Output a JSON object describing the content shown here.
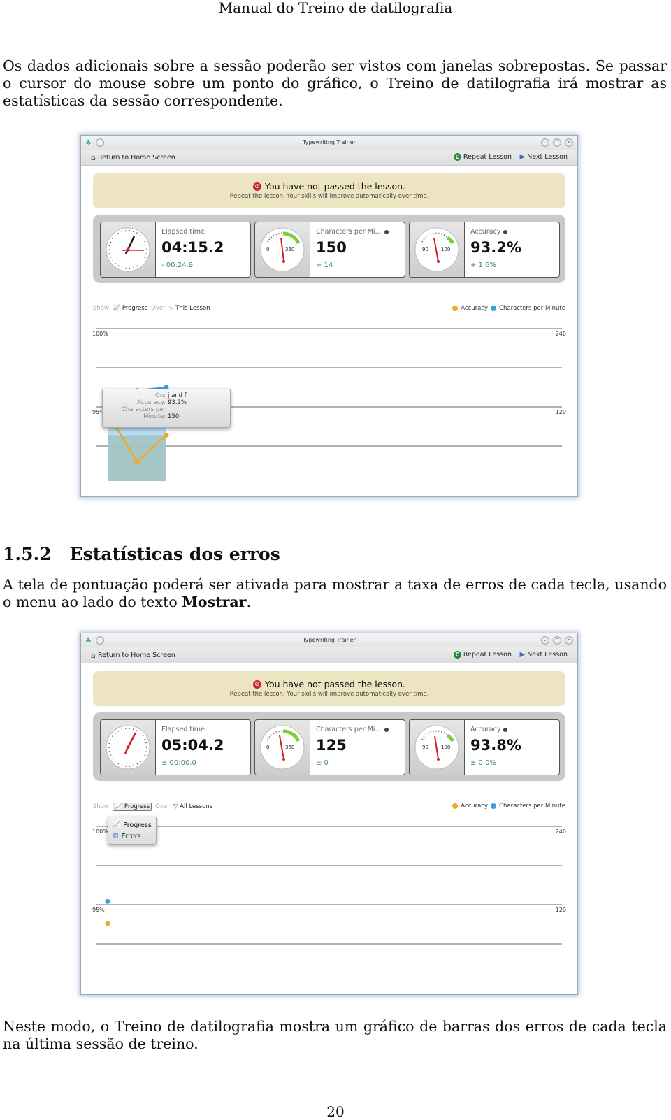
{
  "page": {
    "running_head": "Manual do Treino de datilografia",
    "intro_paragraph": "Os dados adicionais sobre a sessão poderão ser vistos com janelas sobrepostas. Se passar o cursor do mouse sobre um ponto do gráfico, o Treino de datilografia irá mostrar as estatísticas da sessão correspondente.",
    "section": {
      "number": "1.5.2",
      "title": "Estatísticas dos erros"
    },
    "section_paragraph_pre": "A tela de pontuação poderá ser ativada para mostrar a taxa de erros de cada tecla, usando o menu ao lado do texto ",
    "section_paragraph_bold": "Mostrar",
    "section_paragraph_post": ".",
    "closing_paragraph": "Neste modo, o Treino de datilografia mostra um gráfico de barras dos erros de cada tecla na última sessão de treino.",
    "page_number": "20"
  },
  "colors": {
    "accuracy": "#f5a623",
    "cpm": "#3a9fdc",
    "banner_bg": "#ede4c2",
    "delta_text": "#3b8a5a"
  },
  "screenshots": [
    {
      "window_title": "Typewriting Trainer",
      "toolbar": {
        "home": "Return to Home Screen",
        "repeat": "Repeat Lesson",
        "next": "Next Lesson"
      },
      "banner": {
        "title": "You have not passed the lesson.",
        "subtitle": "Repeat the lesson. Your skills will improve automatically over time."
      },
      "stats": {
        "elapsed": {
          "label": "Elapsed time",
          "value": "04:15.2",
          "delta": "- 00:24.9"
        },
        "cpm": {
          "label": "Characters per Mi...",
          "value": "150",
          "delta": "+ 14",
          "gauge_min": "0",
          "gauge_max": "360"
        },
        "accuracy": {
          "label": "Accuracy",
          "value": "93.2%",
          "delta": "+ 1.6%",
          "gauge_min": "90",
          "gauge_max": "100"
        }
      },
      "chart_bar": {
        "show": "Show",
        "mode": "Progress",
        "over": "Over",
        "scope": "This Lesson",
        "legend_accuracy": "Accuracy",
        "legend_cpm": "Characters per Minute"
      },
      "axis": {
        "left_top": "100%",
        "left_mid": "95%",
        "right_top": "240",
        "right_mid": "120"
      },
      "tooltip": {
        "on_label": "On:",
        "on_value": "j and f",
        "acc_label": "Accuracy:",
        "acc_value": "93.2%",
        "cpm_label_1": "Characters per",
        "cpm_label_2": "Minute:",
        "cpm_value": "150"
      }
    },
    {
      "window_title": "Typewriting Trainer",
      "toolbar": {
        "home": "Return to Home Screen",
        "repeat": "Repeat Lesson",
        "next": "Next Lesson"
      },
      "banner": {
        "title": "You have not passed the lesson.",
        "subtitle": "Repeat the lesson. Your skills will improve automatically over time."
      },
      "stats": {
        "elapsed": {
          "label": "Elapsed time",
          "value": "05:04.2",
          "delta": "± 00:00.0"
        },
        "cpm": {
          "label": "Characters per Mi...",
          "value": "125",
          "delta": "± 0",
          "gauge_min": "0",
          "gauge_max": "360"
        },
        "accuracy": {
          "label": "Accuracy",
          "value": "93.8%",
          "delta": "± 0.0%",
          "gauge_min": "90",
          "gauge_max": "100"
        }
      },
      "chart_bar": {
        "show": "Show",
        "mode": "Progress",
        "over": "Over",
        "scope": "All Lessons",
        "legend_accuracy": "Accuracy",
        "legend_cpm": "Characters per Minute"
      },
      "axis": {
        "left_top": "100%",
        "left_mid": "95%",
        "right_top": "240",
        "right_mid": "120"
      },
      "menu": {
        "items": [
          "Progress",
          "Errors"
        ]
      }
    }
  ],
  "chart_data": [
    {
      "type": "line",
      "title": "Progress over This Lesson",
      "x": [
        1,
        2,
        3
      ],
      "series": [
        {
          "name": "Accuracy",
          "axis": "left",
          "values": [
            94.6,
            91.5,
            93.2
          ]
        },
        {
          "name": "Characters per Minute",
          "axis": "right",
          "values": [
            136,
            145,
            150
          ]
        }
      ],
      "left_ticks": [
        "100%",
        "95%"
      ],
      "right_ticks": [
        "240",
        "120"
      ],
      "left_range": [
        90,
        100
      ],
      "right_range": [
        0,
        240
      ],
      "legend": "top-right",
      "grid": true
    },
    {
      "type": "scatter",
      "title": "Progress over All Lessons",
      "x": [
        1
      ],
      "series": [
        {
          "name": "Accuracy",
          "axis": "left",
          "values": [
            93.8
          ]
        },
        {
          "name": "Characters per Minute",
          "axis": "right",
          "values": [
            125
          ]
        }
      ],
      "left_ticks": [
        "100%",
        "95%"
      ],
      "right_ticks": [
        "240",
        "120"
      ],
      "left_range": [
        90,
        100
      ],
      "right_range": [
        0,
        240
      ],
      "legend": "top-right",
      "grid": true
    }
  ]
}
